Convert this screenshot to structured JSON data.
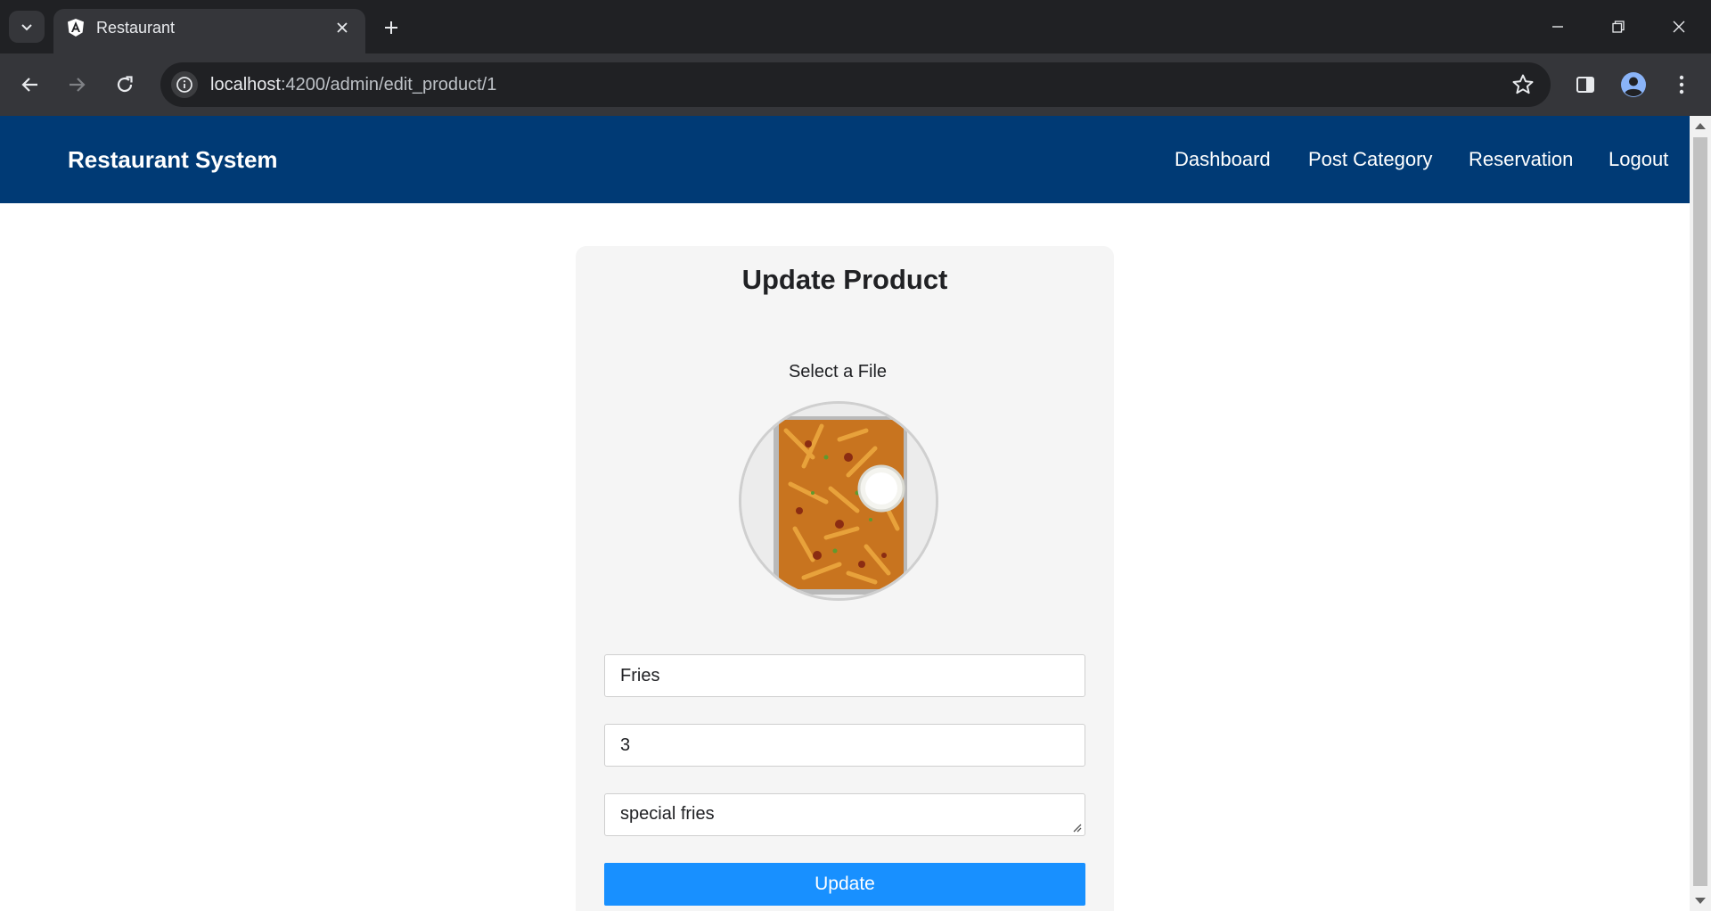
{
  "browser": {
    "tab_title": "Restaurant",
    "url_host": "localhost",
    "url_path": ":4200/admin/edit_product/1"
  },
  "header": {
    "brand": "Restaurant System",
    "nav": {
      "dashboard": "Dashboard",
      "post_category": "Post Category",
      "reservation": "Reservation",
      "logout": "Logout"
    },
    "bg_color": "#003a75"
  },
  "form": {
    "title": "Update Product",
    "file_label": "Select a File",
    "image_alt": "product image - loaded fries",
    "name_value": "Fries",
    "price_value": "3",
    "description_value": "special fries",
    "submit_label": "Update",
    "submit_color": "#1890ff"
  }
}
